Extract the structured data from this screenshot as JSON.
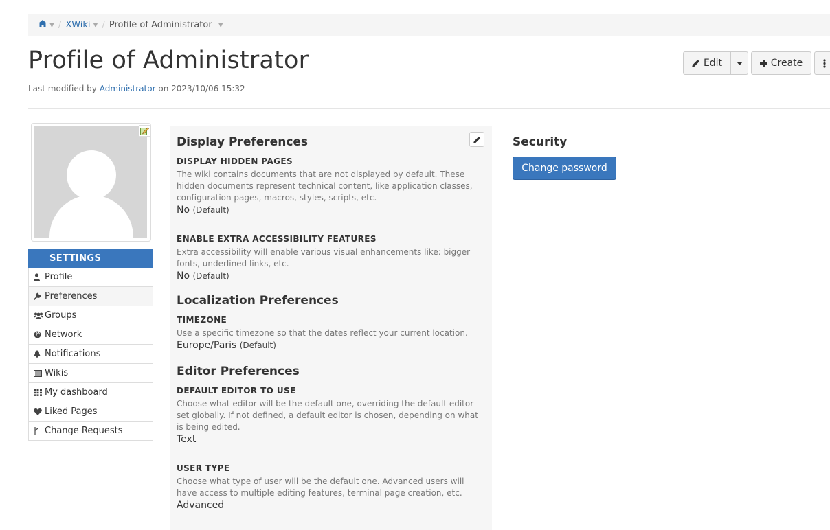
{
  "breadcrumb": {
    "items": [
      "XWiki",
      "Profile of Administrator"
    ],
    "separator": "/"
  },
  "page": {
    "title": "Profile of Administrator",
    "modified_prefix": "Last modified by",
    "modified_user": "Administrator",
    "modified_on": "on 2023/10/06 15:32"
  },
  "toolbar": {
    "edit_label": "Edit",
    "create_label": "Create"
  },
  "sidebar": {
    "header": "SETTINGS",
    "items": [
      {
        "label": "Profile",
        "icon": "user-icon"
      },
      {
        "label": "Preferences",
        "icon": "wrench-icon"
      },
      {
        "label": "Groups",
        "icon": "users-icon"
      },
      {
        "label": "Network",
        "icon": "globe-icon"
      },
      {
        "label": "Notifications",
        "icon": "bell-icon"
      },
      {
        "label": "Wikis",
        "icon": "list-icon"
      },
      {
        "label": "My dashboard",
        "icon": "grid-icon"
      },
      {
        "label": "Liked Pages",
        "icon": "heart-icon"
      },
      {
        "label": "Change Requests",
        "icon": "branch-icon"
      }
    ]
  },
  "preferences": {
    "display": {
      "title": "Display Preferences",
      "hidden": {
        "label": "DISPLAY HIDDEN PAGES",
        "hint": "The wiki contains documents that are not displayed by default. These hidden documents represent technical content, like application classes, configuration pages, macros, styles, scripts, etc.",
        "value": "No",
        "default": "(Default)"
      },
      "accessibility": {
        "label": "ENABLE EXTRA ACCESSIBILITY FEATURES",
        "hint": "Extra accessibility will enable various visual enhancements like: bigger fonts, underlined links, etc.",
        "value": "No",
        "default": "(Default)"
      }
    },
    "localization": {
      "title": "Localization Preferences",
      "timezone": {
        "label": "TIMEZONE",
        "hint": "Use a specific timezone so that the dates reflect your current location.",
        "value": "Europe/Paris",
        "default": "(Default)"
      }
    },
    "editor": {
      "title": "Editor Preferences",
      "default_editor": {
        "label": "DEFAULT EDITOR TO USE",
        "hint": "Choose what editor will be the default one, overriding the default editor set globally. If not defined, a default editor is chosen, depending on what is being edited.",
        "value": "Text"
      },
      "user_type": {
        "label": "USER TYPE",
        "hint": "Choose what type of user will be the default one. Advanced users will have access to multiple editing features, terminal page creation, etc.",
        "value": "Advanced"
      }
    }
  },
  "security": {
    "title": "Security",
    "change_password": "Change password"
  },
  "colors": {
    "accent": "#3a77bd",
    "link": "#2f6fae"
  }
}
